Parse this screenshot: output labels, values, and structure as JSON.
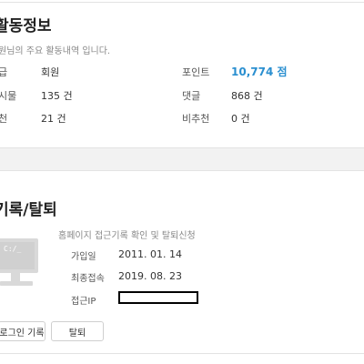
{
  "activity": {
    "title": "활동정보",
    "description": "원님의 주요 활동내역 입니다.",
    "rows": [
      {
        "label1": "급",
        "value1": "회원",
        "label2": "포인트",
        "value2": "10,774 점"
      },
      {
        "label1": "시물",
        "value1": "135 건",
        "label2": "댓글",
        "value2": "868 건"
      },
      {
        "label1": "천",
        "value1": "21 건",
        "label2": "비추천",
        "value2": "0 건"
      }
    ]
  },
  "access": {
    "title": "기록/탈퇴",
    "description": "홈페이지 접근기록 확인 및 탈퇴신청",
    "joined_label": "가입일",
    "joined_value": "2011. 01. 14",
    "last_access_label": "최종접속",
    "last_access_value": "2019. 08. 23",
    "ip_label": "접근IP",
    "login_record_button": "로그인 기록",
    "withdraw_button": "탈퇴"
  },
  "colors": {
    "points": "#2a8fd0",
    "divider": "#e3e3e3",
    "section_gap": "#f2f2f2"
  }
}
